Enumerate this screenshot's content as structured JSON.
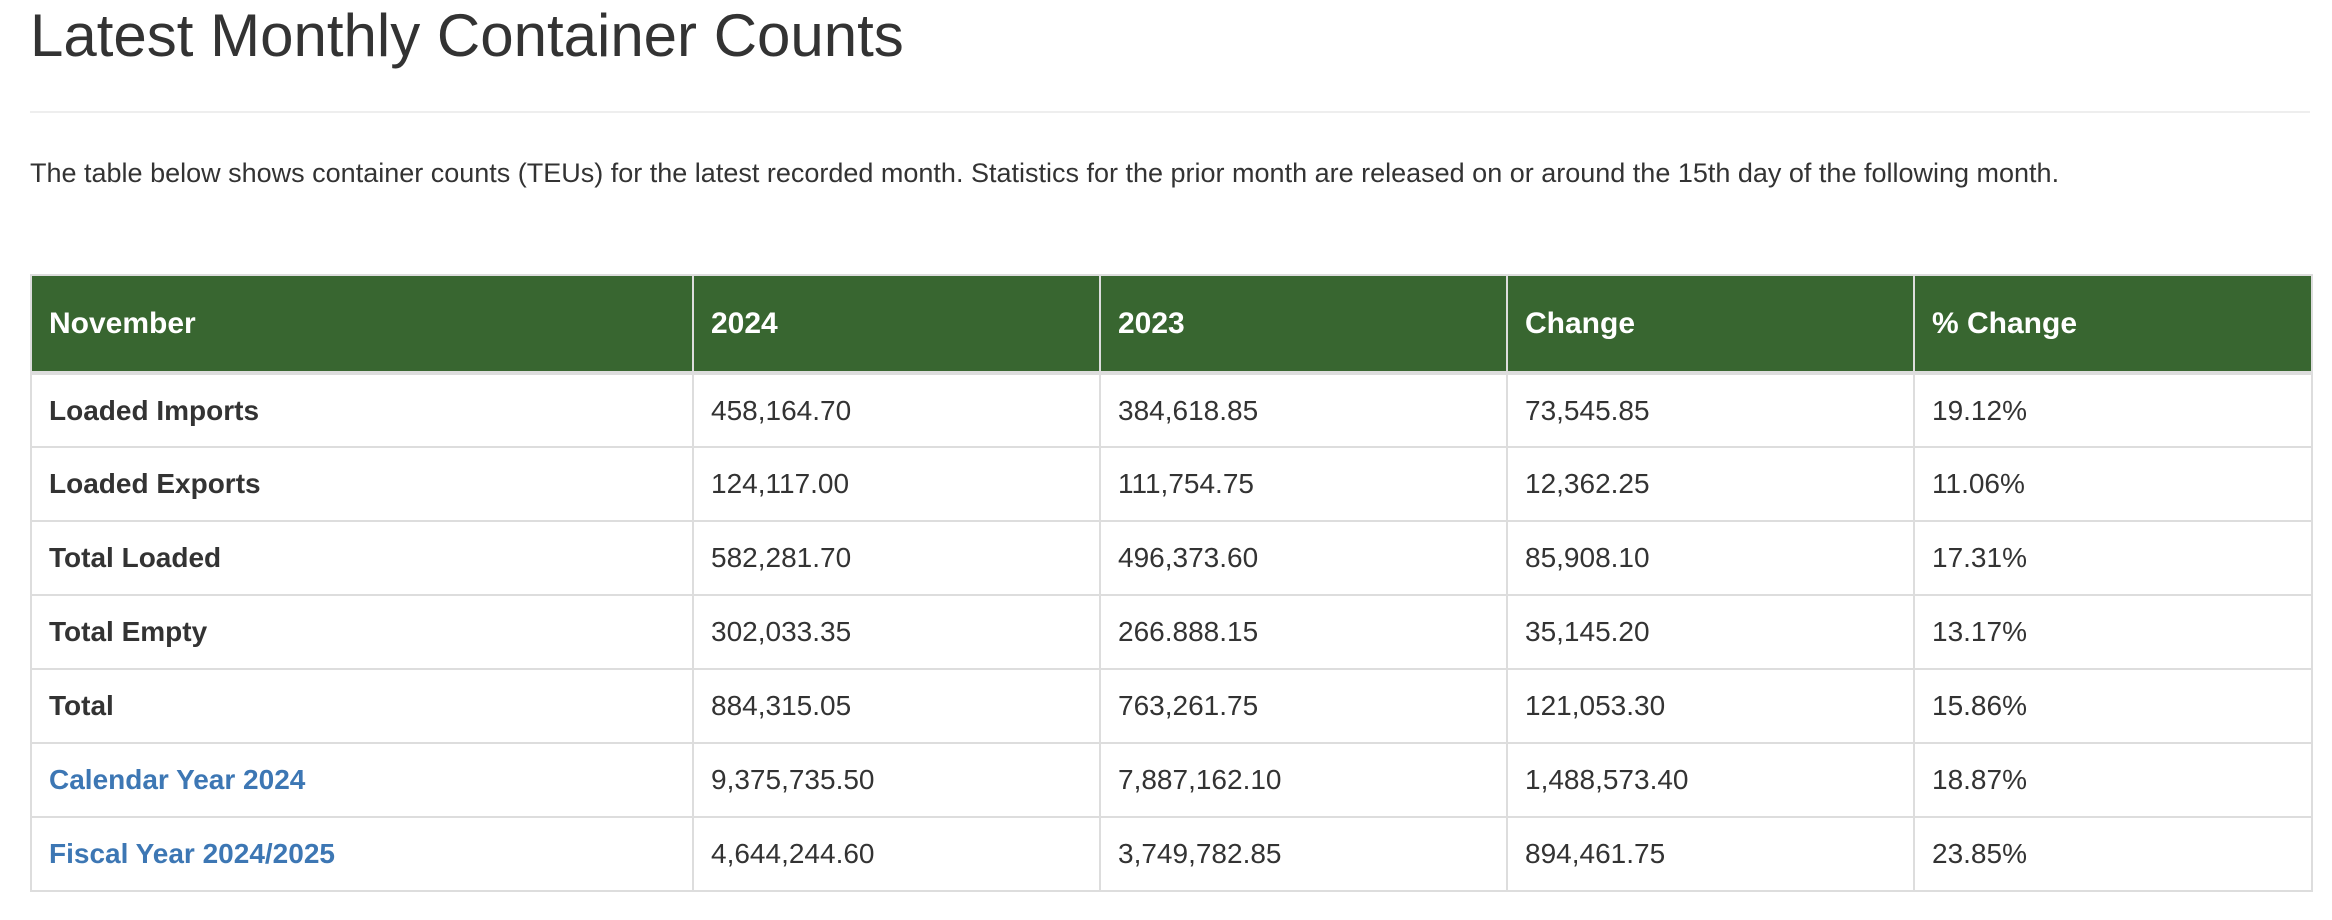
{
  "page": {
    "title": "Latest Monthly Container Counts",
    "intro": "The table below shows container counts (TEUs) for the latest recorded month. Statistics for the prior month are released on or around the 15th day of the following month."
  },
  "colors": {
    "header_bg": "#386630",
    "header_text": "#ffffff",
    "link": "#3d77b4",
    "border": "#dddddd",
    "text": "#333333"
  },
  "table": {
    "headers": [
      "November",
      "2024",
      "2023",
      "Change",
      "% Change"
    ],
    "rows": [
      {
        "label": "Loaded Imports",
        "link": false,
        "y2024": "458,164.70",
        "y2023": "384,618.85",
        "change": "73,545.85",
        "pct": "19.12%"
      },
      {
        "label": "Loaded Exports",
        "link": false,
        "y2024": "124,117.00",
        "y2023": "111,754.75",
        "change": "12,362.25",
        "pct": "11.06%"
      },
      {
        "label": "Total Loaded",
        "link": false,
        "y2024": "582,281.70",
        "y2023": "496,373.60",
        "change": "85,908.10",
        "pct": "17.31%"
      },
      {
        "label": "Total Empty",
        "link": false,
        "y2024": "302,033.35",
        "y2023": "266.888.15",
        "change": "35,145.20",
        "pct": "13.17%"
      },
      {
        "label": "Total",
        "link": false,
        "y2024": "884,315.05",
        "y2023": "763,261.75",
        "change": "121,053.30",
        "pct": "15.86%"
      },
      {
        "label": "Calendar Year 2024",
        "link": true,
        "y2024": "9,375,735.50",
        "y2023": "7,887,162.10",
        "change": "1,488,573.40",
        "pct": "18.87%"
      },
      {
        "label": "Fiscal Year 2024/2025",
        "link": true,
        "y2024": "4,644,244.60",
        "y2023": "3,749,782.85",
        "change": "894,461.75",
        "pct": "23.85%"
      }
    ]
  }
}
